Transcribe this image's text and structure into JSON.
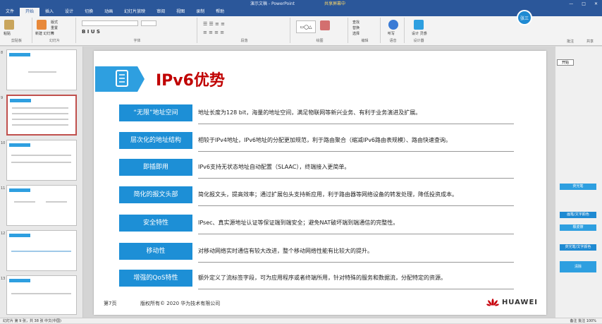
{
  "window": {
    "title": "演示文稿 - PowerPoint",
    "recording_badge": "共享屏幕中"
  },
  "tabs": [
    "文件",
    "开始",
    "插入",
    "设计",
    "切换",
    "动画",
    "幻灯片放映",
    "审阅",
    "视图",
    "录制",
    "帮助"
  ],
  "ribbon": {
    "groups": [
      "剪贴板",
      "幻灯片",
      "字体",
      "段落",
      "绘图",
      "编辑",
      "语音",
      "设计器"
    ],
    "buttons": {
      "paste": "粘贴",
      "new_slide": "新建\n幻灯片",
      "layout": "版式",
      "reset": "重置",
      "section": "节",
      "find": "查找",
      "replace": "替换",
      "select": "选择",
      "dictate": "听写",
      "designer": "设计\n灵感"
    },
    "avatar_text": "张三",
    "share_label": "共享",
    "comments_label": "批注"
  },
  "thumbnails": [
    {
      "num": "8",
      "selected": false
    },
    {
      "num": "9",
      "selected": true
    },
    {
      "num": "10",
      "selected": false
    },
    {
      "num": "11",
      "selected": false
    },
    {
      "num": "12",
      "selected": false
    },
    {
      "num": "13",
      "selected": false
    }
  ],
  "slide": {
    "title": "IPv6优势",
    "rows": [
      {
        "label": "“无限”地址空间",
        "text": "地址长度为128 bit，海量的地址空间，满足物联网等新兴业务、有利于业务演进及扩展。"
      },
      {
        "label": "层次化的地址结构",
        "text": "相较于IPv4地址，IPv6地址的分配更加规范，利于路由聚合（缩减IPv6路由表规模）、路由快速查询。"
      },
      {
        "label": "即插即用",
        "text": "IPv6支持无状态地址自动配置（SLAAC），终端接入更简单。"
      },
      {
        "label": "简化的报文头部",
        "text": "简化报文头，提高效率；通过扩展包头支持新应用，利于路由器等网络设备的转发处理，降低投资成本。"
      },
      {
        "label": "安全特性",
        "text": "IPsec、真实源地址认证等保证端到端安全；避免NAT破坏端到端通信的完整性。"
      },
      {
        "label": "移动性",
        "text": "对移动网络实时通信有较大改进，整个移动网络性能有比较大的提升。"
      },
      {
        "label": "增强的QoS特性",
        "text": "额外定义了流标签字段，可为应用程序或者终端所用，针对特殊的服务和数据流，分配特定的资源。"
      }
    ],
    "page": "第7页",
    "copyright": "版权所有© 2020 华为技术有限公司",
    "brand": "HUAWEI"
  },
  "right_pane": {
    "start": "开始",
    "items": [
      "荧光笔",
      "画笔/文字颜色",
      "橡皮擦",
      "荧光笔/文字颜色",
      "清除"
    ]
  },
  "status": {
    "left": "幻灯片 第 9 张，共 38 张   中文(中国)",
    "right": "备注   批注   100%"
  },
  "colors": {
    "accent": "#1d8fd6",
    "title_red": "#c00000",
    "ribbon_blue": "#2b579a"
  }
}
